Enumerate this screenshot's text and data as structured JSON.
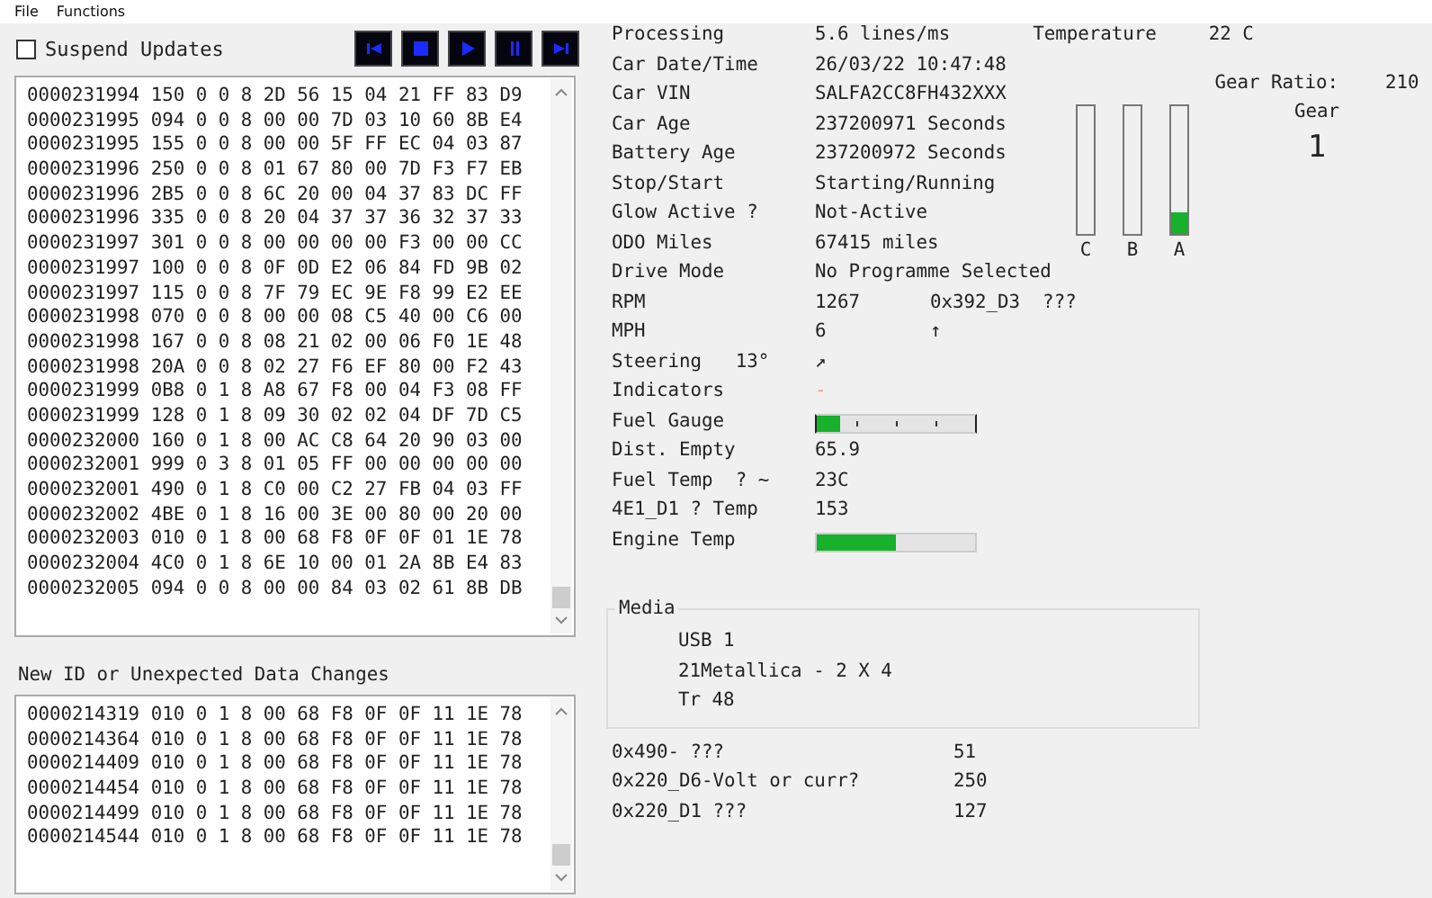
{
  "menu": [
    "File",
    "Functions"
  ],
  "suspend": {
    "label": "Suspend Updates",
    "checked": false
  },
  "transport_buttons": [
    {
      "kind": "skip-back"
    },
    {
      "kind": "stop"
    },
    {
      "kind": "play"
    },
    {
      "kind": "pause"
    },
    {
      "kind": "skip-forward"
    }
  ],
  "log": [
    "0000231994 150 0 0 8 2D 56 15 04 21 FF 83 D9",
    "0000231995 094 0 0 8 00 00 7D 03 10 60 8B E4",
    "0000231995 155 0 0 8 00 00 5F FF EC 04 03 87",
    "0000231996 250 0 0 8 01 67 80 00 7D F3 F7 EB",
    "0000231996 2B5 0 0 8 6C 20 00 04 37 83 DC FF",
    "0000231996 335 0 0 8 20 04 37 37 36 32 37 33",
    "0000231997 301 0 0 8 00 00 00 00 F3 00 00 CC",
    "0000231997 100 0 0 8 0F 0D E2 06 84 FD 9B 02",
    "0000231997 115 0 0 8 7F 79 EC 9E F8 99 E2 EE",
    "0000231998 070 0 0 8 00 00 08 C5 40 00 C6 00",
    "0000231998 167 0 0 8 08 21 02 00 06 F0 1E 48",
    "0000231998 20A 0 0 8 02 27 F6 EF 80 00 F2 43",
    "0000231999 0B8 0 1 8 A8 67 F8 00 04 F3 08 FF",
    "0000231999 128 0 1 8 09 30 02 02 04 DF 7D C5",
    "0000232000 160 0 1 8 00 AC C8 64 20 90 03 00",
    "0000232001 999 0 3 8 01 05 FF 00 00 00 00 00",
    "0000232001 490 0 1 8 C0 00 C2 27 FB 04 03 FF",
    "0000232002 4BE 0 1 8 16 00 3E 00 80 00 20 00",
    "0000232003 010 0 1 8 00 68 F8 0F 0F 01 1E 78",
    "0000232004 4C0 0 1 8 6E 10 00 01 2A 8B E4 83",
    "0000232005 094 0 0 8 00 00 84 03 02 61 8B DB"
  ],
  "changes_title": "New ID or Unexpected Data Changes",
  "changes": [
    "0000214319 010 0 1 8 00 68 F8 0F 0F 11 1E 78",
    "0000214364 010 0 1 8 00 68 F8 0F 0F 11 1E 78",
    "0000214409 010 0 1 8 00 68 F8 0F 0F 11 1E 78",
    "0000214454 010 0 1 8 00 68 F8 0F 0F 11 1E 78",
    "0000214499 010 0 1 8 00 68 F8 0F 0F 11 1E 78",
    "0000214544 010 0 1 8 00 68 F8 0F 0F 11 1E 78"
  ],
  "temperature": {
    "label": "Temperature",
    "value": "22 C"
  },
  "info_rows": [
    {
      "kind": "text",
      "label": "Processing",
      "value": "5.6 lines/ms"
    },
    {
      "kind": "text",
      "label": "Car Date/Time",
      "value": "26/03/22 10:47:48"
    },
    {
      "kind": "text",
      "label": "Car VIN",
      "value": "SALFA2CC8FH432XXX"
    },
    {
      "kind": "text",
      "label": "Car Age",
      "value": "237200971 Seconds"
    },
    {
      "kind": "text",
      "label": "Battery Age",
      "value": "237200972 Seconds"
    },
    {
      "kind": "text",
      "label": "Stop/Start",
      "value": "Starting/Running"
    },
    {
      "kind": "text",
      "label": "Glow Active ?",
      "value": "Not-Active"
    },
    {
      "kind": "text",
      "label": "ODO Miles",
      "value": "67415 miles"
    },
    {
      "kind": "text",
      "label": "Drive Mode",
      "value": "No Programme Selected"
    },
    {
      "kind": "text",
      "label": "RPM",
      "value": "1267",
      "extra": "0x392_D3  ???"
    },
    {
      "kind": "text",
      "label": "MPH",
      "value": "6",
      "extra": "↑"
    },
    {
      "kind": "text",
      "label": "Steering   13°",
      "value": "↗"
    },
    {
      "kind": "indicator",
      "label": "Indicators",
      "value": "-"
    },
    {
      "kind": "gauge",
      "label": "Fuel Gauge",
      "level": 0.15,
      "ticks": true
    },
    {
      "kind": "text",
      "label": "Dist. Empty",
      "value": "65.9"
    },
    {
      "kind": "text",
      "label": "Fuel Temp  ? ~",
      "value": "23C"
    },
    {
      "kind": "text",
      "label": "4E1_D1 ? Temp",
      "value": "153"
    },
    {
      "kind": "gauge",
      "label": "Engine Temp",
      "level": 0.5,
      "ticks": false
    }
  ],
  "meters": [
    {
      "label": "C",
      "level": 0
    },
    {
      "label": "B",
      "level": 0
    },
    {
      "label": "A",
      "level": 0.17
    }
  ],
  "gear": {
    "ratio_label": "Gear Ratio:",
    "ratio": "210",
    "label": "Gear",
    "value": "1"
  },
  "media": {
    "title": "Media",
    "lines": [
      "USB 1",
      "21Metallica - 2 X 4",
      "Tr 48"
    ]
  },
  "extra_rows": [
    {
      "label": "0x490- ???",
      "value": "51"
    },
    {
      "label": "0x220_D6-Volt or curr?",
      "value": "250"
    },
    {
      "label": "0x220_D1 ???",
      "value": "127"
    }
  ]
}
